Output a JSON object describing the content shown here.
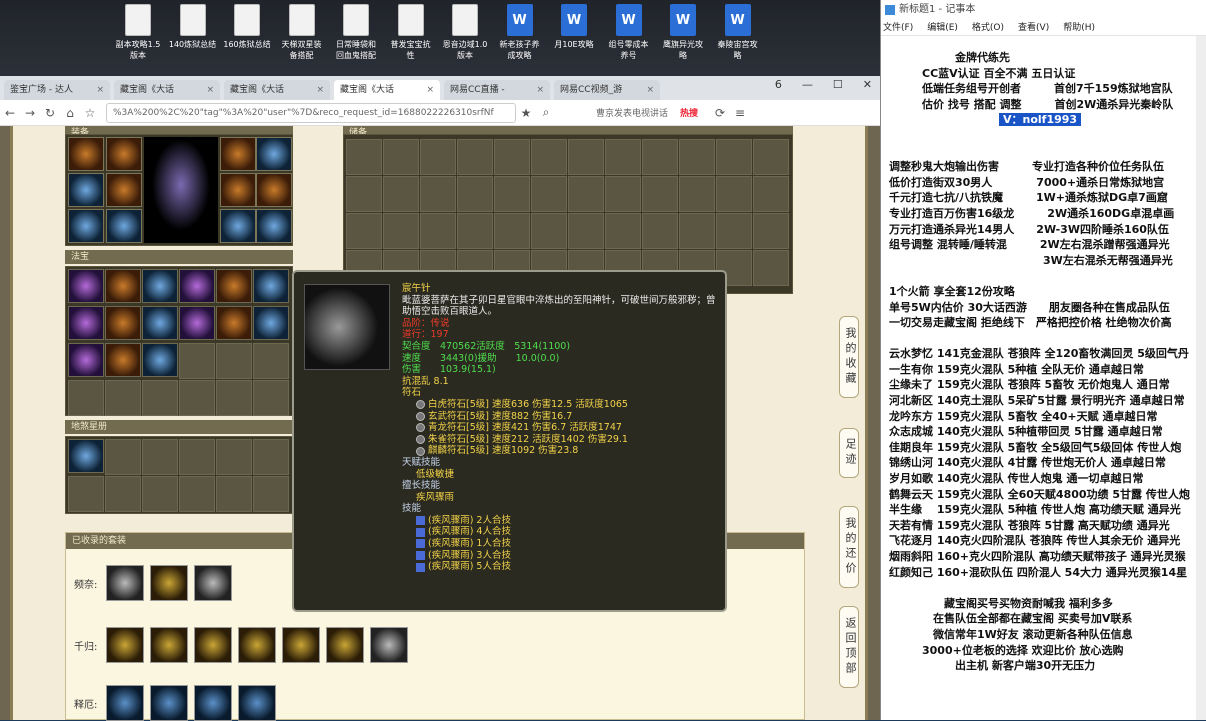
{
  "desktop_icons": [
    {
      "label": "副本攻略1.5\n版本",
      "type": "txt"
    },
    {
      "label": "140炼狱总结",
      "type": "txt"
    },
    {
      "label": "160炼狱总结",
      "type": "txt"
    },
    {
      "label": "天梯双星装\n备搭配",
      "type": "txt"
    },
    {
      "label": "日常睡袋和\n回血鬼搭配",
      "type": "txt"
    },
    {
      "label": "普发宝宝抗\n性",
      "type": "txt"
    },
    {
      "label": "恩音边域1.0\n版本",
      "type": "txt"
    },
    {
      "label": "新老孩子养\n成攻略",
      "type": "doc"
    },
    {
      "label": "月10E攻略",
      "type": "doc"
    },
    {
      "label": "组号零成本\n养号",
      "type": "doc"
    },
    {
      "label": "鹰旗异光攻\n略",
      "type": "doc"
    },
    {
      "label": "秦陵宙宫攻\n略",
      "type": "doc"
    }
  ],
  "browser": {
    "tabs": [
      {
        "label": "鉴宝广场 - 达人",
        "active": false
      },
      {
        "label": "藏宝阁《大话",
        "active": false
      },
      {
        "label": "藏宝阁《大话",
        "active": false
      },
      {
        "label": "藏宝阁《大话",
        "active": true
      },
      {
        "label": "网易CC直播 - ",
        "active": false
      },
      {
        "label": "网易CC视频_游",
        "active": false
      }
    ],
    "tab_count": "6",
    "url": "%3A%200%2C%20\"tag\"%3A%20\"user\"%7D&reco_request_id=1688022226310srfNf",
    "search_hint": "曹京发表电视讲话",
    "hot_label": "热搜"
  },
  "page": {
    "sections": {
      "equip": "装备",
      "fabao": "法宝",
      "ground": "地煞星册",
      "storage": "储备",
      "collected_sets": "已收录的套装"
    },
    "set_rows": [
      {
        "label": "频奈:",
        "count": 3
      },
      {
        "label": "千归:",
        "count": 7
      },
      {
        "label": "释厄:",
        "count": 4
      }
    ],
    "side_buttons": [
      "我的收藏",
      "足迹",
      "我的还价",
      "返回顶部"
    ]
  },
  "tooltip": {
    "name": "宸午针",
    "desc": "毗蓝婆菩萨在其子卯日星官眼中淬炼出的至阳神针，可破世间万般邪秽；曾助悟空击败百眼道人。",
    "attr1": "品阶：传说",
    "attr2": "道行：197",
    "stats": [
      "契合度　470562活跃度　5314(1100)",
      "速度　　3443(0)援助　　10.0(0.0)",
      "伤害　　103.9(15.1)"
    ],
    "resist": "抗混乱 8.1",
    "rune_label": "符石",
    "runes": [
      "白虎符石[5级] 速度636 伤害12.5 活跃度1065",
      "玄武符石[5级] 速度882 伤害16.7",
      "青龙符石[5级] 速度421 伤害6.7 活跃度1747",
      "朱雀符石[5级] 速度212 活跃度1402 伤害29.1",
      "麒麟符石[5级] 速度1092 伤害23.8"
    ],
    "talent_label": "天赋技能",
    "talent": "低级敏捷",
    "expert_label": "擅长技能",
    "expert": "疾风骤雨",
    "skill_label": "技能",
    "skills": [
      "(疾风骤雨) 2人合技",
      "(疾风骤雨) 4人合技",
      "(疾风骤雨) 1人合技",
      "(疾风骤雨) 3人合技",
      "(疾风骤雨) 5人合技"
    ]
  },
  "notepad": {
    "title": "新标题1 - 记事本",
    "menu": [
      "文件(F)",
      "编辑(E)",
      "格式(O)",
      "查看(V)",
      "帮助(H)"
    ],
    "lines": [
      "　　　　　　金牌代练先",
      "　　　CC蓝V认证 百全不满 五日认证",
      "　　　低端任务组号开创者　　　首创7千159炼狱地宫队",
      "　　　估价 找号 搭配 调整　　　首创2W通杀异光秦岭队",
      "",
      "",
      "调整秒鬼大炮输出伤害　　　专业打造各种价位任务队伍",
      "低价打造街双30男人　　　　7000+通杀日常炼狱地宫",
      "千元打造七抗/八抗铁魔　　　1W+通杀炼狱DG卓7画窟",
      "专业打造百万伤害16级龙　　　2W通杀160DG卓混卓画",
      "万元打造通杀异光14男人　　2W-3W四阶睡杀160队伍",
      "组号调整 混转睡/睡转混　　　2W左右混杀蹭帮强通异光",
      "　　　　　　　　　　　　　　3W左右混杀无帮强通异光",
      "",
      "1个火箭 享全套12份攻略",
      "单号5W内估价 30大话西游　　朋友圈各种在售成品队伍",
      "一切交易走藏宝阁 拒绝线下　严格把控价格 杜绝物次价高",
      "",
      "云水梦忆 141克金混队 苍狼阵 全120畜牧满回灵 5级回气丹",
      "一生有你 159克火混队 5种植 全队无价 通卓越日常",
      "尘缘未了 159克火混队 苍狼阵 5畜牧 无价炮鬼人 通日常",
      "河北新区 140克土混队 5呆矿5甘露 景行明光齐 通卓越日常",
      "龙吟东方 159克火混队 5畜牧 全40+天赋 通卓越日常",
      "众志成城 140克火混队 5种植带回灵 5甘露 通卓越日常",
      "佳期良年 159克火混队 5畜牧 全5级回气5级回体 传世人炮",
      "锦绣山河 140克火混队 4甘露 传世炮无价人 通卓越日常",
      "岁月如歌 140克火混队 传世人炮鬼 通一切卓越日常",
      "鹤舞云天 159克火混队 全60天赋4800功绩 5甘露 传世人炮",
      "半生缘　 159克火混队 5种植 传世人炮 高功绩天赋 通异光",
      "天若有情 159克火混队 苍狼阵 5甘露 高天赋功绩 通异光",
      "飞花逐月 140克火四阶混队 苍狼阵 传世人其余无价 通异光",
      "烟雨斜阳 160+克火四阶混队 高功绩天赋带孩子 通异光灵猴",
      "红颜知己 160+混砍队伍 四阶混人 54大力 通异光灵猴14星",
      "",
      "　　　　　藏宝阁买号买物资耐喊我 福利多多",
      "　　　　在售队伍全部都在藏宝阁 买卖号加V联系",
      "　　　　微信常年1W好友 滚动更新各种队伍信息",
      "　　　3000+位老板的选择 欢迎比价 放心选购",
      "　　　　　　出主机 新客户端30开无压力"
    ],
    "highlight": "V：nolf1993"
  }
}
